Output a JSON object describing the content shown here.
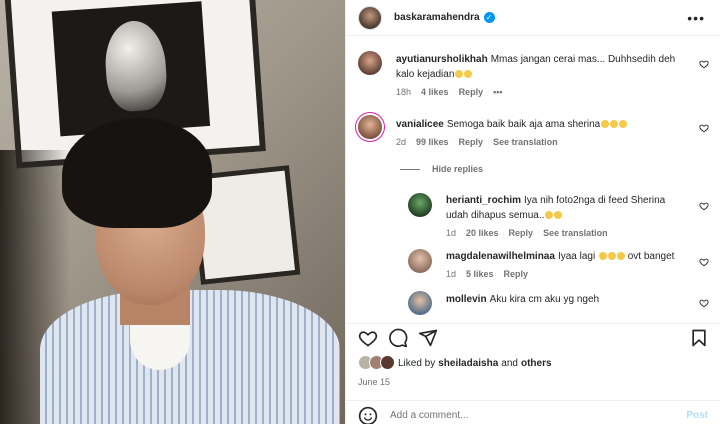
{
  "post": {
    "username": "baskaramahendra",
    "verified_icon": "verified-badge-icon",
    "more_icon": "more-horizontal-icon"
  },
  "comments": [
    {
      "username": "ayutianursholikhah",
      "text": "Mmas jangan cerai mas... Duhhsedih deh kalo kejadian",
      "emoji_count": 2,
      "time": "18h",
      "likes": "4 likes",
      "reply": "Reply",
      "extra": "•••"
    },
    {
      "username": "vanialicee",
      "text": "Semoga baik baik aja ama sherina",
      "emoji_count": 3,
      "time": "2d",
      "likes": "99 likes",
      "reply": "Reply",
      "see_translation": "See translation"
    }
  ],
  "hide_replies": "Hide replies",
  "replies": [
    {
      "username": "herianti_rochim",
      "text": "Iya nih foto2nga di feed Sherina udah dihapus semua..",
      "emoji_count": 2,
      "time": "1d",
      "likes": "20 likes",
      "reply": "Reply",
      "see_translation": "See translation"
    },
    {
      "username": "magdalenawilhelminaa",
      "text": "Iyaa lagi",
      "emoji_count": 3,
      "text_after": "ovt banget",
      "time": "1d",
      "likes": "5 likes",
      "reply": "Reply"
    },
    {
      "username": "mollevin",
      "text": "Aku kira cm aku yg ngeh",
      "time": "",
      "likes": "",
      "reply": ""
    }
  ],
  "liked_by": {
    "prefix": "Liked by",
    "user": "sheiladaisha",
    "conj": "and",
    "others": "others"
  },
  "date": "June 15",
  "add_comment": {
    "placeholder": "Add a comment...",
    "post_label": "Post"
  },
  "colors": {
    "accent": "#0095f6",
    "muted": "#737373",
    "post_disabled": "#b2dffc"
  }
}
